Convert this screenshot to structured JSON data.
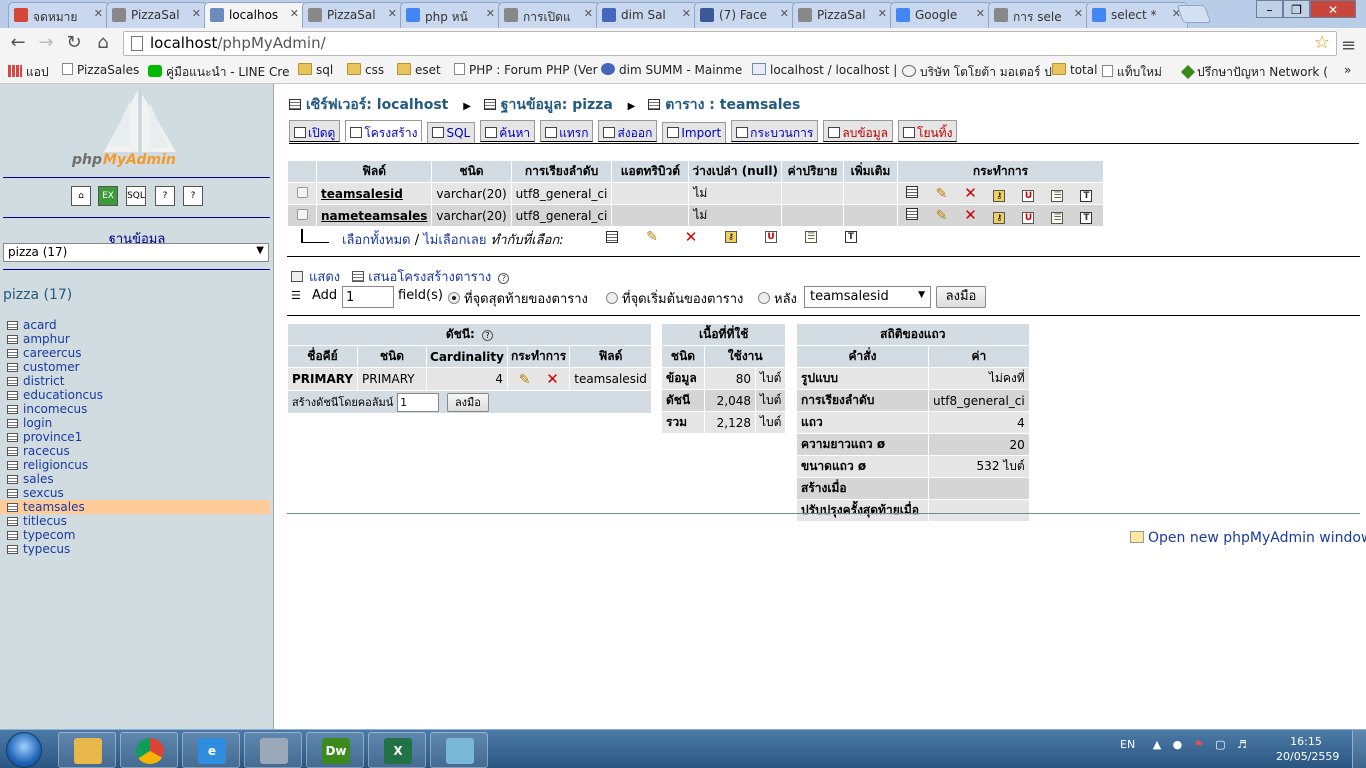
{
  "browser": {
    "tabs": [
      {
        "label": "จดหมาย",
        "icon": "mail-icon",
        "color": "#d44638"
      },
      {
        "label": "PizzaSal",
        "icon": "page-icon",
        "color": "#888888"
      },
      {
        "label": "localhos",
        "icon": "pma-icon",
        "color": "#6c8cbc",
        "active": true
      },
      {
        "label": "PizzaSal",
        "icon": "page-icon",
        "color": "#888888"
      },
      {
        "label": "php หน้",
        "icon": "google-icon",
        "color": "#4285f4"
      },
      {
        "label": "การเปิดแ",
        "icon": "page-icon",
        "color": "#888888"
      },
      {
        "label": "dim Sal",
        "icon": "gear-icon",
        "color": "#4466bb"
      },
      {
        "label": "(7) Face",
        "icon": "facebook-icon",
        "color": "#3b5998"
      },
      {
        "label": "PizzaSal",
        "icon": "page-icon",
        "color": "#888888"
      },
      {
        "label": "Google",
        "icon": "google-icon",
        "color": "#4285f4"
      },
      {
        "label": "การ sele",
        "icon": "page-icon",
        "color": "#888888"
      },
      {
        "label": "select *",
        "icon": "google-icon",
        "color": "#4285f4"
      }
    ],
    "url_host": "localhost",
    "url_path": "/phpMyAdmin/",
    "bookmarks": [
      {
        "label": "แอป",
        "icon": "apps-icon"
      },
      {
        "label": "PizzaSales",
        "icon": "page-icon"
      },
      {
        "label": "คู่มือแนะนำ - LINE Cre",
        "icon": "line-icon"
      },
      {
        "label": "sql",
        "icon": "folder-icon"
      },
      {
        "label": "css",
        "icon": "folder-icon"
      },
      {
        "label": "eset",
        "icon": "folder-icon"
      },
      {
        "label": "PHP : Forum PHP (Ver",
        "icon": "page-icon"
      },
      {
        "label": "dim SUMM - Mainme",
        "icon": "gear-icon"
      },
      {
        "label": "localhost / localhost |",
        "icon": "pma-icon"
      },
      {
        "label": "บริษัท โตโยต้า มอเตอร์ ป",
        "icon": "toyota-icon"
      },
      {
        "label": "total",
        "icon": "folder-icon"
      },
      {
        "label": "แท็บใหม่",
        "icon": "page-icon"
      },
      {
        "label": "ปรึกษาปัญหา Network (",
        "icon": "diamond-icon"
      }
    ]
  },
  "left": {
    "logo_text": "phpMyAdmin",
    "db_label": "ฐานข้อมูล",
    "db_selected": "pizza (17)",
    "db_title": "pizza (17)",
    "tables": [
      "acard",
      "amphur",
      "careercus",
      "customer",
      "district",
      "educationcus",
      "incomecus",
      "login",
      "province1",
      "racecus",
      "religioncus",
      "sales",
      "sexcus",
      "teamsales",
      "titlecus",
      "typecom",
      "typecus"
    ],
    "selected_table": "teamsales"
  },
  "main": {
    "crumb": {
      "server_label": "เซิร์ฟเวอร์: localhost",
      "db_label": "ฐานข้อมูล: pizza",
      "table_label": "ตาราง : teamsales"
    },
    "tabs": [
      {
        "label": "เปิดดู",
        "icon": "browse-icon"
      },
      {
        "label": "โครงสร้าง",
        "icon": "structure-icon",
        "active": true
      },
      {
        "label": "SQL",
        "icon": "sql-icon"
      },
      {
        "label": "ค้นหา",
        "icon": "search-icon"
      },
      {
        "label": "แทรก",
        "icon": "insert-icon"
      },
      {
        "label": "ส่งออก",
        "icon": "export-icon"
      },
      {
        "label": "Import",
        "icon": "import-icon"
      },
      {
        "label": "กระบวนการ",
        "icon": "operations-icon"
      },
      {
        "label": "ลบข้อมูล",
        "icon": "empty-icon",
        "red": true
      },
      {
        "label": "โยนทิ้ง",
        "icon": "drop-icon",
        "red": true
      }
    ],
    "structure": {
      "headers": [
        "ฟิลด์",
        "ชนิด",
        "การเรียงลำดับ",
        "แอตทริบิวต์",
        "ว่างเปล่า (null)",
        "ค่าปริยาย",
        "เพิ่มเติม",
        "กระทำการ"
      ],
      "rows": [
        {
          "field": "teamsalesid",
          "type": "varchar(20)",
          "collation": "utf8_general_ci",
          "attributes": "",
          "null": "ไม่",
          "default": "",
          "extra": ""
        },
        {
          "field": "nameteamsales",
          "type": "varchar(20)",
          "collation": "utf8_general_ci",
          "attributes": "",
          "null": "ไม่",
          "default": "",
          "extra": ""
        }
      ],
      "check_all": "เลือกทั้งหมด",
      "uncheck_all": "ไม่เลือกเลย",
      "with_selected": "ทำกับที่เลือก:"
    },
    "print_view": "แสดง",
    "propose_structure": "เสนอโครงสร้างตาราง",
    "add_fields": {
      "add_label": "Add",
      "count": "1",
      "fields_label": "field(s)",
      "at_end": "ที่จุดสุดท้ายของตาราง",
      "at_beginning": "ที่จุดเริ่มต้นของตาราง",
      "after": "หลัง",
      "after_field": "teamsalesid",
      "go": "ลงมือ"
    },
    "indexes": {
      "title": "ดัชนี:",
      "headers": [
        "ชื่อคีย์",
        "ชนิด",
        "Cardinality",
        "กระทำการ",
        "ฟิลด์"
      ],
      "rows": [
        {
          "keyname": "PRIMARY",
          "type": "PRIMARY",
          "cardinality": "4",
          "field": "teamsalesid"
        }
      ],
      "create_label": "สร้างดัชนีโดยคอลัมน์",
      "create_count": "1",
      "go": "ลงมือ"
    },
    "space_usage": {
      "title": "เนื้อที่ที่ใช้",
      "headers": [
        "ชนิด",
        "ใช้งาน"
      ],
      "rows": [
        {
          "type": "ข้อมูล",
          "value": "80",
          "unit": "ไบต์"
        },
        {
          "type": "ดัชนี",
          "value": "2,048",
          "unit": "ไบต์"
        },
        {
          "type": "รวม",
          "value": "2,128",
          "unit": "ไบต์"
        }
      ]
    },
    "row_stats": {
      "title": "สถิติของแถว",
      "headers": [
        "คำสั่ง",
        "ค่า"
      ],
      "rows": [
        {
          "label": "รูปแบบ",
          "value": "ไม่คงที่"
        },
        {
          "label": "การเรียงลำดับ",
          "value": "utf8_general_ci"
        },
        {
          "label": "แถว",
          "value": "4"
        },
        {
          "label": "ความยาวแถว ø",
          "value": "20"
        },
        {
          "label": "ขนาดแถว ø",
          "value": "532 ไบต์"
        },
        {
          "label": "สร้างเมื่อ",
          "value": ""
        },
        {
          "label": "ปรับปรุงครั้งสุดท้ายเมื่อ",
          "value": ""
        }
      ]
    },
    "open_new_window": "Open new phpMyAdmin window"
  },
  "taskbar": {
    "apps": [
      {
        "name": "explorer",
        "icon": "folder-icon",
        "color": "#e8b84a",
        "text": ""
      },
      {
        "name": "chrome",
        "icon": "chrome-icon",
        "color": "#dd4b39",
        "text": ""
      },
      {
        "name": "ie",
        "icon": "ie-icon",
        "color": "#2f8de0",
        "text": "e"
      },
      {
        "name": "calculator",
        "icon": "calculator-icon",
        "color": "#9aa8b8",
        "text": ""
      },
      {
        "name": "dreamweaver",
        "icon": "dreamweaver-icon",
        "color": "#3c8a1e",
        "text": "Dw"
      },
      {
        "name": "excel",
        "icon": "excel-icon",
        "color": "#217346",
        "text": "X"
      },
      {
        "name": "notepad",
        "icon": "notepad-icon",
        "color": "#7ab8d8",
        "text": ""
      }
    ],
    "lang": "EN",
    "time": "16:15",
    "date": "20/05/2559"
  }
}
